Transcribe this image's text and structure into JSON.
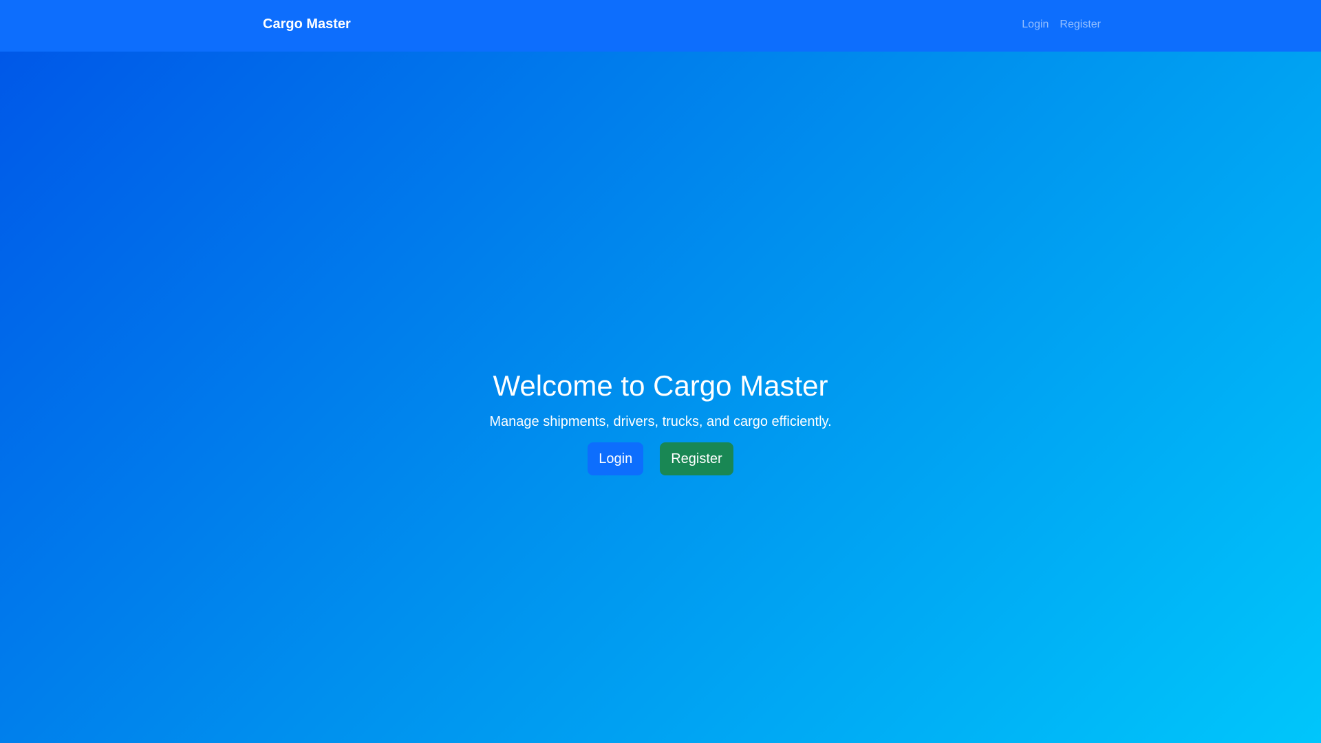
{
  "navbar": {
    "brand": "Cargo Master",
    "links": [
      {
        "label": "Login"
      },
      {
        "label": "Register"
      }
    ]
  },
  "hero": {
    "title": "Welcome to Cargo Master",
    "subtitle": "Manage shipments, drivers, trucks, and cargo efficiently.",
    "login_label": "Login",
    "register_label": "Register"
  },
  "colors": {
    "navbar": "#0d6efd",
    "primary": "#0d6efd",
    "success": "#198754"
  }
}
